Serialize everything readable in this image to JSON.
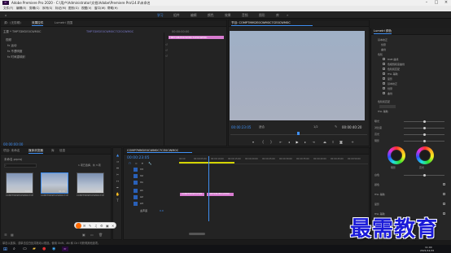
{
  "titlebar": {
    "title": "Adobe Premiere Pro 2020 - C:\\用户\\Administrator\\文档\\Adobe\\Premiere Pro\\14.0\\未命名"
  },
  "menu": [
    "文件(F)",
    "编辑(E)",
    "剪辑(C)",
    "序列(S)",
    "标记(M)",
    "图形(G)",
    "视图(V)",
    "窗口(W)",
    "帮助(H)"
  ],
  "workspaces": [
    "学习",
    "组件",
    "编辑",
    "颜色",
    "效果",
    "音频",
    "图形",
    "库"
  ],
  "source_panel": {
    "tabs": [
      "源：(无剪辑)",
      "效果控件",
      "Lumetri 范围"
    ],
    "clip_name": "主要 * TMP7DM2E0CWM0C",
    "sequence": "TMP7DM2E0CWM0C7CE0CWM0C",
    "timecode": "00:00:00:00",
    "rows": [
      "视频",
      "fx 运动",
      "fx 不透明度",
      "fx 时间重映射"
    ],
    "clip_label": "TMP7DM2E0CWM0C7CE0CWM0C"
  },
  "program_monitor": {
    "tab": "节目: COMP7MM2E0CWM0C7CE0CWM0C",
    "timecode": "00:00:23:05",
    "fit": "适合",
    "scale": "1/2",
    "duration": "00:00:40:20"
  },
  "project_panel": {
    "tabs": [
      "项目: 未命名",
      "媒体浏览器",
      "库",
      "信息"
    ],
    "project_file": "未命名.prproj",
    "count": "1 项已选择，共 3 项",
    "items": [
      {
        "name": "COMP7MM2E0CWM0C7CE0C...",
        "duration": "5:00"
      },
      {
        "name": "COMP7MM2E0CWM0C7CE0C...",
        "duration": "40:20"
      },
      {
        "name": "COMP7MM2E0CWM0C7CE0C...",
        "duration": "5:00"
      }
    ]
  },
  "timeline": {
    "tab": "COMP7MM2E0CWM0C7CE0CWM0C",
    "timecode": "00:00:23:05",
    "ruler": [
      "00:00",
      "00:00:05:00",
      "00:00:10:00",
      "00:00:15:00",
      "00:00:20:00",
      "00:00:25:00",
      "00:00:30:00",
      "00:00:35:00",
      "00:00:40:00",
      "00:00:45:00",
      "00:00:50:00",
      "00:00:55:00"
    ],
    "tracks": [
      "V3",
      "V2",
      "V1",
      "A1",
      "A2",
      "A3",
      "主声道"
    ],
    "master_value": "0.0",
    "clips": [
      "COMP7MM2E0CWM",
      "TMP7DM2E0CWM0C"
    ]
  },
  "lumetri": {
    "title": "Lumetri 颜色",
    "sections": [
      "基本校正",
      "创意",
      "曲线",
      "色轮和匹配",
      "HSL 辅助",
      "晕影"
    ],
    "items": [
      "基本校正",
      "创意",
      "曲线",
      "色轮",
      "RGB 曲线",
      "色相饱和度曲线",
      "色轮和匹配",
      "HSL 辅助",
      "晕影"
    ],
    "sliders": [
      "曝光",
      "对比度",
      "高光",
      "阴影",
      "白色",
      "黑色"
    ],
    "wheel_labels": [
      "阴影",
      "高光"
    ],
    "hsl_label": "HSL 辅助",
    "checkboxes": [
      "颜色",
      "HSL 辅助",
      "晕影"
    ]
  },
  "status": {
    "text": "单击以选择，或单击空白处并拖动以框选。使用 Shift、Alt 和 Ctrl 可获得其他选项。"
  },
  "taskbar": {
    "time": "11:04",
    "date": "2021/12/15"
  },
  "watermark": "最需教育"
}
